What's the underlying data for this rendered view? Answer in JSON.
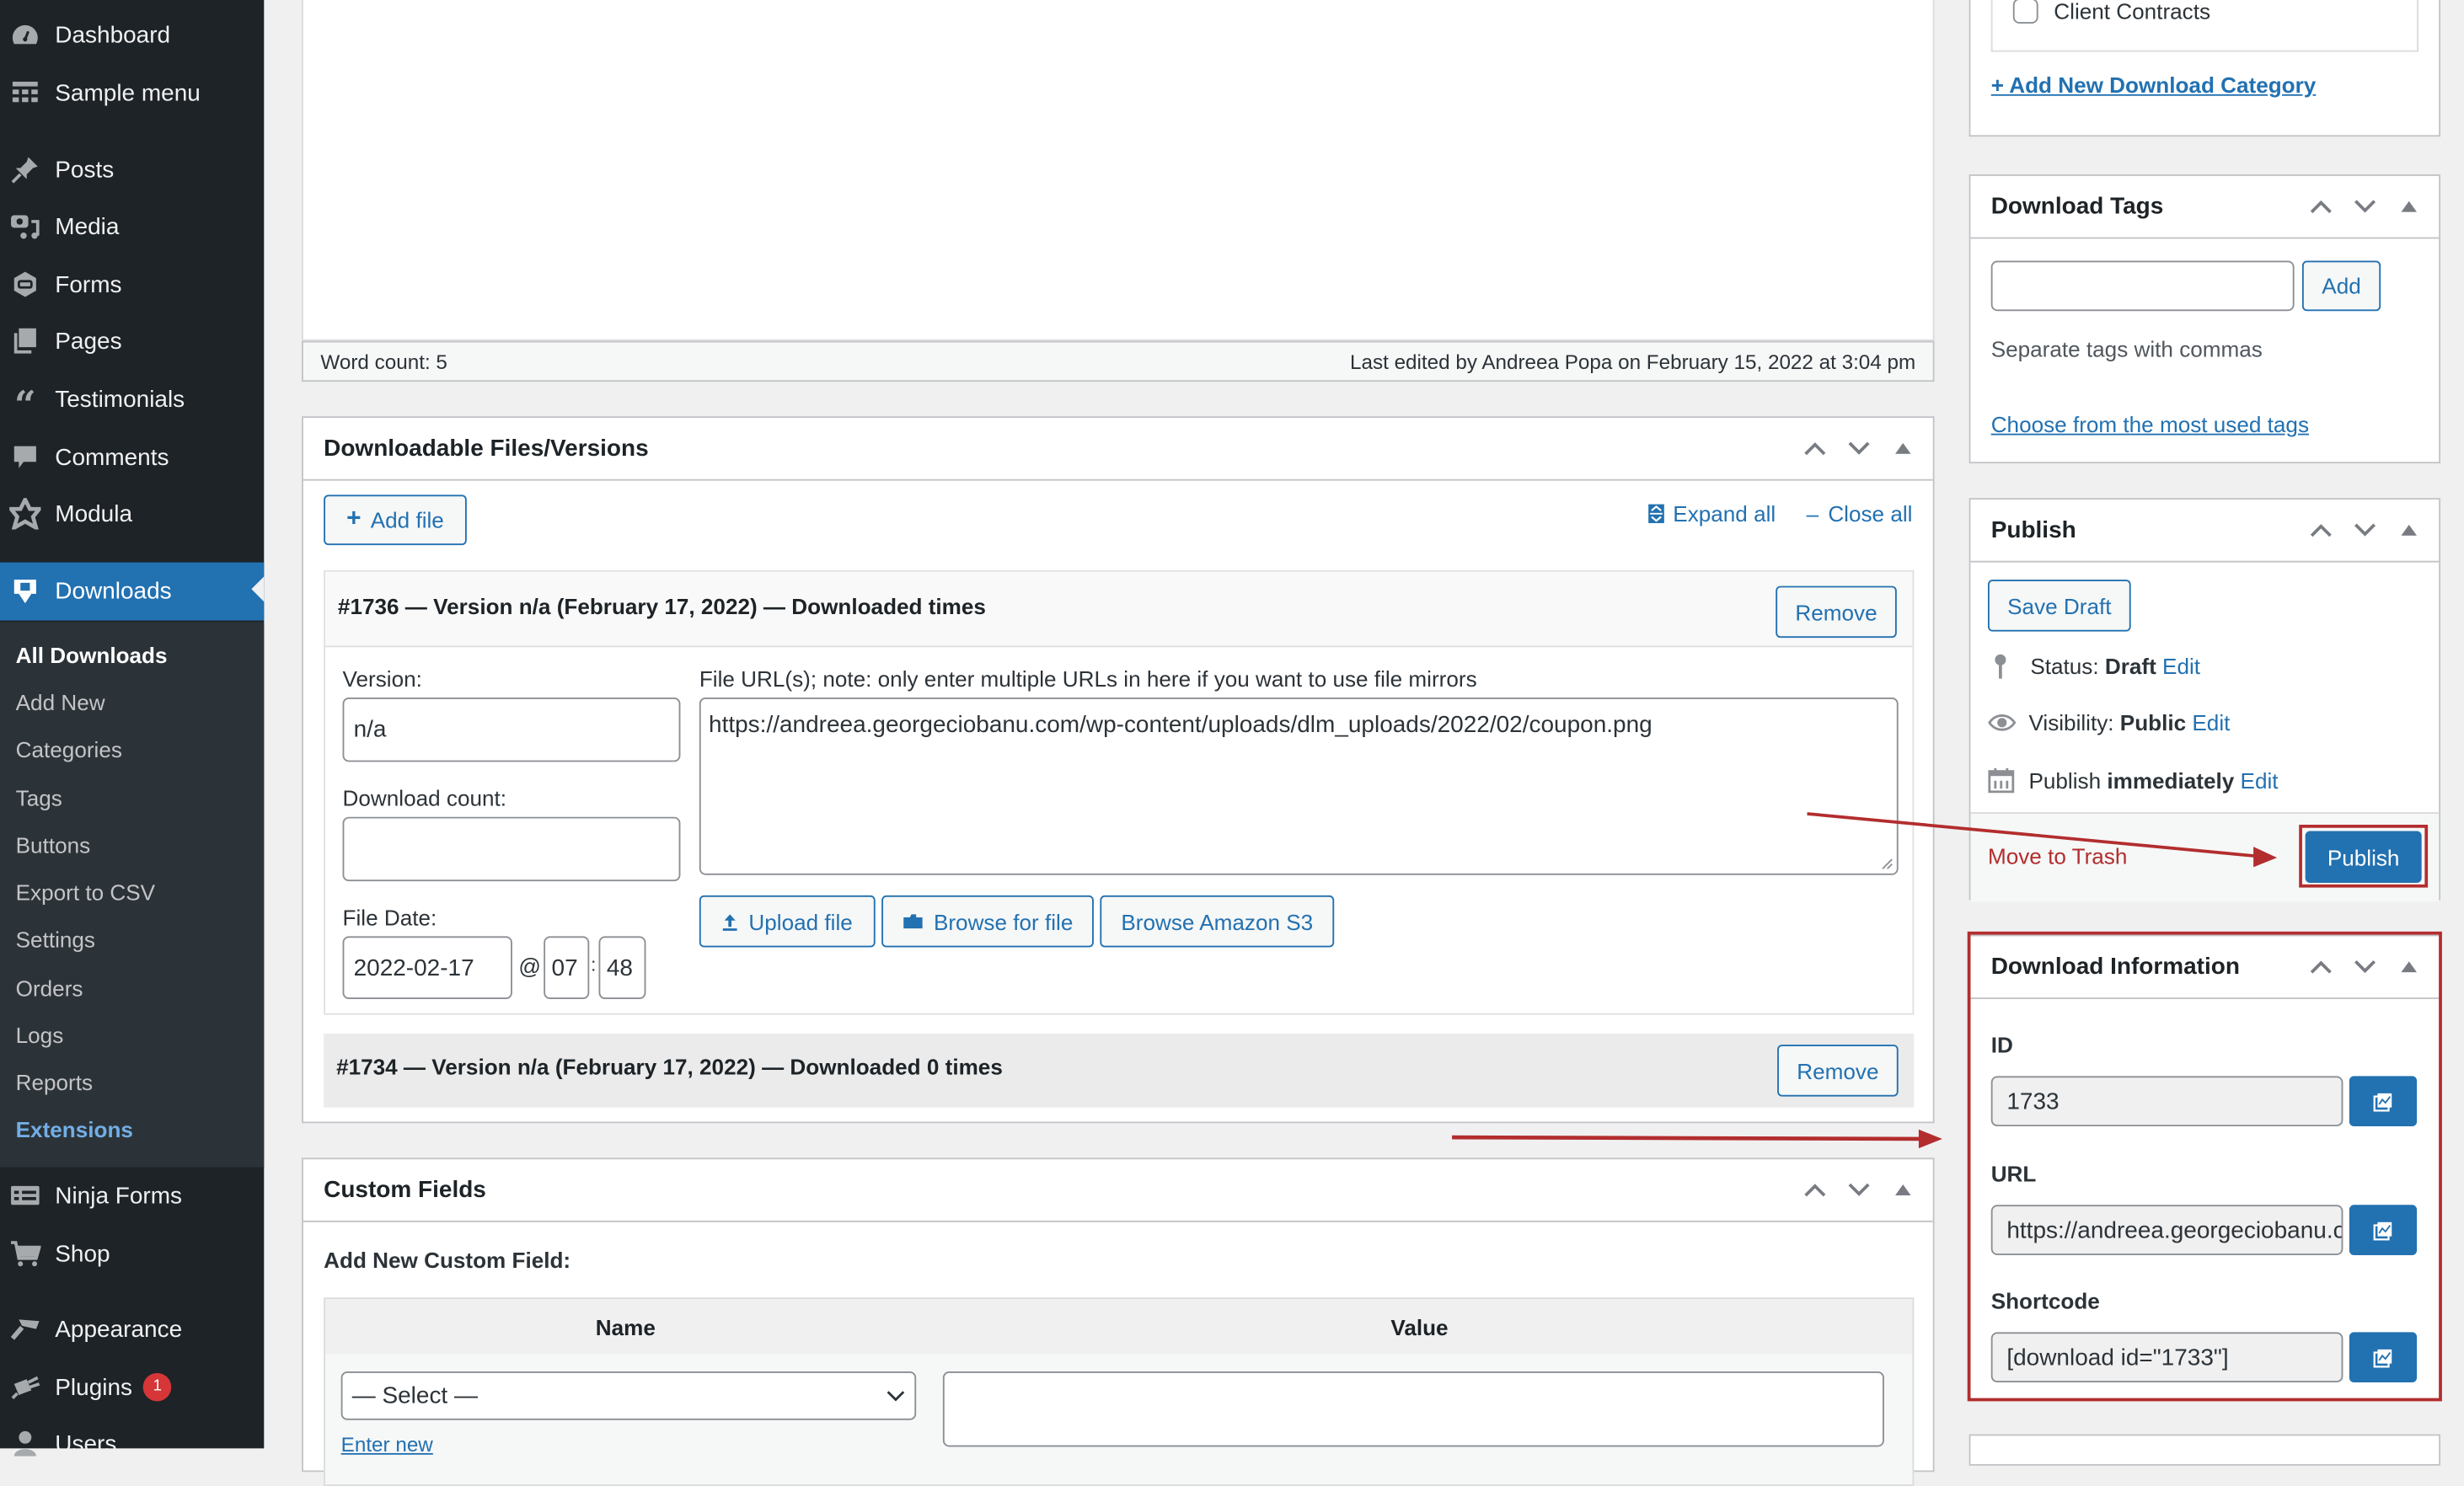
{
  "sidebar": {
    "items": [
      {
        "label": "Dashboard",
        "icon": "dashboard-icon"
      },
      {
        "label": "Sample menu",
        "icon": "table-layout-icon"
      },
      {
        "label": "Posts",
        "icon": "pin-icon"
      },
      {
        "label": "Media",
        "icon": "media-icon"
      },
      {
        "label": "Forms",
        "icon": "forms-icon"
      },
      {
        "label": "Pages",
        "icon": "pages-icon"
      },
      {
        "label": "Testimonials",
        "icon": "quote-icon"
      },
      {
        "label": "Comments",
        "icon": "comment-icon"
      },
      {
        "label": "Modula",
        "icon": "modula-icon"
      },
      {
        "label": "Downloads",
        "icon": "download-icon"
      },
      {
        "label": "Ninja Forms",
        "icon": "ninja-forms-icon"
      },
      {
        "label": "Shop",
        "icon": "cart-icon"
      },
      {
        "label": "Appearance",
        "icon": "brush-icon"
      },
      {
        "label": "Plugins",
        "icon": "plug-icon",
        "badge": "1"
      },
      {
        "label": "Users",
        "icon": "user-icon"
      }
    ],
    "submenu": [
      "All Downloads",
      "Add New",
      "Categories",
      "Tags",
      "Buttons",
      "Export to CSV",
      "Settings",
      "Orders",
      "Logs",
      "Reports",
      "Extensions"
    ]
  },
  "editor": {
    "word_count": "Word count: 5",
    "last_edited": "Last edited by Andreea Popa on February 15, 2022 at 3:04 pm"
  },
  "files_box": {
    "title": "Downloadable Files/Versions",
    "add_file": "Add file",
    "expand_all": "Expand all",
    "close_all": "Close all",
    "versions": [
      {
        "title": "#1736 — Version n/a (February 17, 2022) — Downloaded times",
        "remove": "Remove",
        "version_label": "Version:",
        "version_value": "n/a",
        "count_label": "Download count:",
        "count_value": "",
        "date_label": "File Date:",
        "date_value": "2022-02-17",
        "at": "@",
        "hour": "07",
        "sep": ":",
        "minute": "48",
        "url_label": "File URL(s); note: only enter multiple URLs in here if you want to use file mirrors",
        "url_value": "https://andreea.georgeciobanu.com/wp-content/uploads/dlm_uploads/2022/02/coupon.png",
        "upload": "Upload file",
        "browse": "Browse for file",
        "browse_s3": "Browse Amazon S3"
      },
      {
        "title": "#1734 — Version n/a (February 17, 2022) — Downloaded 0 times",
        "remove": "Remove"
      }
    ]
  },
  "custom_fields": {
    "title": "Custom Fields",
    "add_new": "Add New Custom Field:",
    "col_name": "Name",
    "col_value": "Value",
    "select_value": "— Select —",
    "enter_new": "Enter new"
  },
  "categories": {
    "item": "Client Contracts",
    "add_new": "+ Add New Download Category"
  },
  "tags_box": {
    "title": "Download Tags",
    "input_value": "",
    "add": "Add",
    "hint": "Separate tags with commas",
    "most_used": "Choose from the most used tags"
  },
  "publish_box": {
    "title": "Publish",
    "save_draft": "Save Draft",
    "status_label": "Status:",
    "status_value": "Draft",
    "visibility_label": "Visibility:",
    "visibility_value": "Public",
    "publish_label": "Publish",
    "publish_value": "immediately",
    "edit": "Edit",
    "trash": "Move to Trash",
    "publish_button": "Publish"
  },
  "info_box": {
    "title": "Download Information",
    "id_label": "ID",
    "id_value": "1733",
    "url_label": "URL",
    "url_value": "https://andreea.georgeciobanu.com/download/coupon/",
    "shortcode_label": "Shortcode",
    "shortcode_value": "[download id=\"1733\"]"
  },
  "colors": {
    "accent": "#2271b1",
    "annotation": "#b32d2e",
    "sidebar_bg": "#1d2327"
  }
}
